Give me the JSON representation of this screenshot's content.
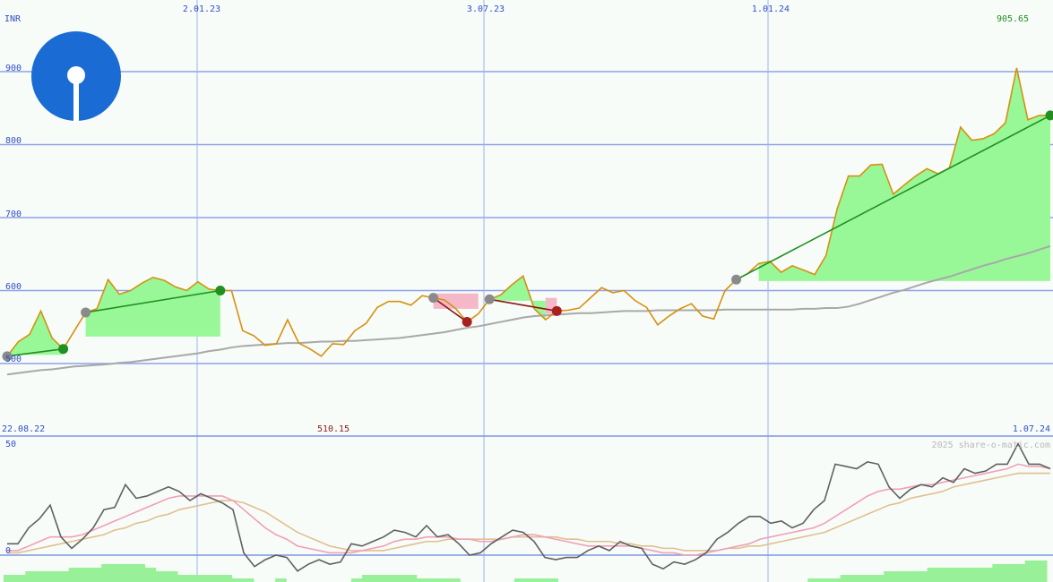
{
  "chart_data": [
    {
      "type": "line",
      "currency": "INR",
      "x_ticks": [
        "2.01.23",
        "3.07.23",
        "1.01.24"
      ],
      "x_start_label": "22.08.22",
      "x_end_label": "1.07.24",
      "max_label": "905.65",
      "min_label": "510.15",
      "y_ticks": [
        500,
        600,
        700,
        800,
        900
      ],
      "ylim": [
        480,
        930
      ],
      "grid": true,
      "series": [
        {
          "values": [
            510,
            530,
            540,
            572,
            535,
            520,
            545,
            570,
            575,
            615,
            595,
            600,
            610,
            618,
            614,
            605,
            600,
            612,
            602,
            600,
            600,
            545,
            538,
            525,
            527,
            560,
            528,
            520,
            510,
            527,
            526,
            545,
            555,
            577,
            585,
            585,
            580,
            593,
            590,
            587,
            575,
            557,
            568,
            588,
            594,
            608,
            620,
            575,
            560,
            572,
            573,
            576,
            590,
            604,
            597,
            600,
            586,
            577,
            553,
            565,
            575,
            582,
            565,
            561,
            600,
            615,
            623,
            637,
            640,
            625,
            634,
            628,
            622,
            648,
            712,
            757,
            757,
            772,
            773,
            732,
            745,
            757,
            767,
            760,
            768,
            824,
            806,
            808,
            815,
            830,
            905,
            834,
            840,
            840
          ],
          "sma_values": [
            485,
            487,
            489,
            491,
            492,
            494,
            496,
            497,
            498,
            499,
            501,
            502,
            504,
            506,
            508,
            510,
            512,
            514,
            517,
            519,
            522,
            524,
            525,
            526,
            527,
            528,
            528,
            529,
            530,
            530,
            531,
            531,
            532,
            533,
            534,
            535,
            537,
            539,
            541,
            543,
            546,
            549,
            551,
            554,
            557,
            560,
            563,
            565,
            566,
            567,
            568,
            569,
            569,
            570,
            571,
            572,
            572,
            572,
            573,
            573,
            573,
            573,
            573,
            573,
            574,
            574,
            574,
            574,
            574,
            574,
            574,
            575,
            575,
            576,
            576,
            578,
            582,
            587,
            592,
            597,
            601,
            606,
            611,
            615,
            619,
            624,
            629,
            634,
            638,
            643,
            647,
            651,
            656,
            661
          ]
        }
      ]
    },
    {
      "type": "line",
      "y_ticks": [
        0,
        50
      ],
      "ylim": [
        -15,
        55
      ],
      "watermark": "2025 share-o-matic.com",
      "series": [
        {
          "values": [
            5,
            5,
            12,
            16,
            22,
            8,
            3,
            7,
            12,
            20,
            21,
            31,
            25,
            26,
            28,
            30,
            28,
            24,
            27,
            25,
            23,
            20,
            1,
            -5,
            -2,
            0,
            -1,
            -7,
            -4,
            -2,
            -4,
            -3,
            5,
            4,
            6,
            8,
            11,
            10,
            8,
            13,
            8,
            9,
            5,
            0,
            1,
            5,
            8,
            11,
            10,
            6,
            -1,
            -2,
            -1,
            -1,
            2,
            4,
            2,
            6,
            4,
            3,
            -4,
            -6,
            -3,
            -4,
            -2,
            1,
            7,
            10,
            14,
            17,
            17,
            14,
            15,
            12,
            14,
            20,
            24,
            40,
            39,
            38,
            41,
            40,
            30,
            25,
            29,
            31,
            30,
            34,
            32,
            38,
            36,
            37,
            40,
            40,
            49,
            40,
            40,
            38
          ]
        },
        {
          "values": [
            2,
            2,
            4,
            6,
            8,
            8,
            8,
            9,
            11,
            13,
            15,
            17,
            19,
            21,
            23,
            25,
            26,
            26,
            26,
            26,
            26,
            24,
            20,
            16,
            12,
            9,
            7,
            4,
            3,
            2,
            1,
            1,
            1,
            2,
            3,
            4,
            6,
            7,
            7,
            8,
            8,
            8,
            7,
            7,
            6,
            6,
            7,
            8,
            9,
            9,
            8,
            7,
            6,
            5,
            4,
            4,
            4,
            4,
            4,
            3,
            2,
            1,
            1,
            0,
            0,
            1,
            2,
            3,
            4,
            5,
            7,
            8,
            9,
            10,
            11,
            12,
            14,
            17,
            20,
            23,
            26,
            28,
            29,
            29,
            30,
            31,
            31,
            32,
            33,
            34,
            35,
            36,
            37,
            38,
            40,
            39,
            39,
            38
          ]
        },
        {
          "values": [
            1,
            1,
            2,
            3,
            4,
            5,
            6,
            7,
            8,
            9,
            11,
            12,
            14,
            15,
            17,
            18,
            20,
            21,
            22,
            23,
            24,
            24,
            23,
            21,
            19,
            16,
            13,
            10,
            8,
            6,
            4,
            3,
            2,
            2,
            2,
            2,
            3,
            4,
            5,
            6,
            6,
            7,
            7,
            7,
            7,
            7,
            7,
            8,
            8,
            8,
            8,
            8,
            7,
            7,
            6,
            6,
            6,
            5,
            5,
            4,
            4,
            3,
            3,
            2,
            2,
            2,
            2,
            3,
            3,
            4,
            4,
            5,
            6,
            7,
            8,
            9,
            10,
            12,
            14,
            16,
            18,
            20,
            22,
            23,
            25,
            26,
            27,
            28,
            30,
            31,
            32,
            33,
            34,
            35,
            36,
            36,
            36,
            36
          ]
        }
      ]
    }
  ]
}
